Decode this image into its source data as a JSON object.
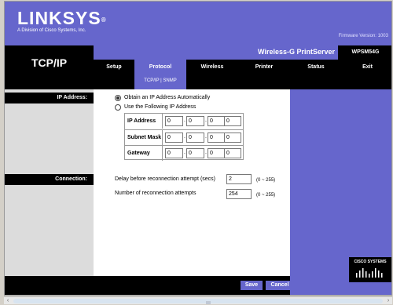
{
  "brand": {
    "name": "LINKSYS",
    "registered": "®",
    "subtitle": "A Division of Cisco Systems, Inc.",
    "firmware": "Firmware Version:  1003"
  },
  "page_title": "TCP/IP",
  "product": {
    "name": "Wireless-G PrintServer",
    "model": "WPSM54G"
  },
  "tabs": [
    {
      "label": "Setup",
      "active": false
    },
    {
      "label": "Protocol",
      "active": true
    },
    {
      "label": "Wireless",
      "active": false
    },
    {
      "label": "Printer",
      "active": false
    },
    {
      "label": "Status",
      "active": false
    },
    {
      "label": "Exit",
      "active": false
    }
  ],
  "submenu": {
    "items": [
      "TCP/IP",
      "SNMP"
    ],
    "separator": "|"
  },
  "ip_section": {
    "heading": "IP Address:",
    "auto_label": "Obtain an IP Address Automatically",
    "manual_label": "Use the Following IP Address",
    "selected": "auto",
    "rows": [
      {
        "label": "IP Address",
        "octets": [
          "0",
          "0",
          "0",
          "0"
        ]
      },
      {
        "label": "Subnet Mask",
        "octets": [
          "0",
          "0",
          "0",
          "0"
        ]
      },
      {
        "label": "Gateway",
        "octets": [
          "0",
          "0",
          "0",
          "0"
        ]
      }
    ],
    "dot": "."
  },
  "connection": {
    "heading": "Connection:",
    "delay_label": "Delay before reconnection attempt (secs)",
    "delay_value": "2",
    "delay_range": "(0 ~ 255)",
    "attempts_label": "Number of reconnection attempts",
    "attempts_value": "254",
    "attempts_range": "(0 ~ 255)"
  },
  "buttons": {
    "save": "Save",
    "cancel": "Cancel"
  },
  "cisco": {
    "text": "CISCO SYSTEMS"
  },
  "scrollbar": {
    "left": "‹",
    "right": "›"
  },
  "colors": {
    "brand_purple": "#6666cc",
    "black": "#000000",
    "left_gray": "#dcdcdc"
  }
}
